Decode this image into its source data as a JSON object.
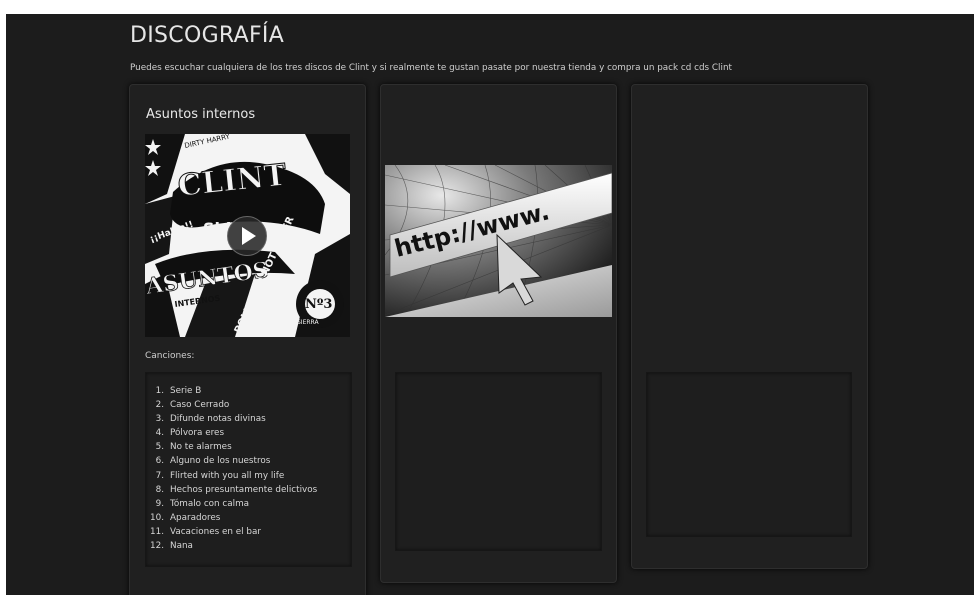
{
  "page": {
    "title": "DISCOGRAFÍA",
    "intro": "Puedes escuchar cualquiera de los tres discos de Clint y si realmente te gustan pasate por nuestra tienda y compra un pack cd cds Clint"
  },
  "albums": [
    {
      "title": "Asuntos internos",
      "songs_label": "Canciones:",
      "tracks": [
        {
          "num": "1.",
          "name": "Serie B"
        },
        {
          "num": "2.",
          "name": "Caso Cerrado"
        },
        {
          "num": "3.",
          "name": "Difunde notas divinas"
        },
        {
          "num": "4.",
          "name": "Pólvora eres"
        },
        {
          "num": "5.",
          "name": "No te alarmes"
        },
        {
          "num": "6.",
          "name": "Alguno de los nuestros"
        },
        {
          "num": "7.",
          "name": "Flirted with you all my life"
        },
        {
          "num": "8.",
          "name": "Hechos presuntamente delictivos"
        },
        {
          "num": "9.",
          "name": "Tómalo con calma"
        },
        {
          "num": "10.",
          "name": "Aparadores"
        },
        {
          "num": "11.",
          "name": "Vacaciones en el bar"
        },
        {
          "num": "12.",
          "name": "Nana"
        }
      ]
    }
  ],
  "cover_art": {
    "words": [
      "DIRTY HARRY",
      "CLINT",
      "¡¡Habla!!",
      "Shh",
      "ASUNTOS",
      "INTERNOS",
      "POLICE DO NOT ENTER",
      "Nº3",
      "SIERRA"
    ]
  },
  "placeholder_image": {
    "text": "http://www."
  },
  "colors": {
    "background": "#1c1c1c",
    "card": "#202020",
    "text": "#d6d6d6"
  }
}
